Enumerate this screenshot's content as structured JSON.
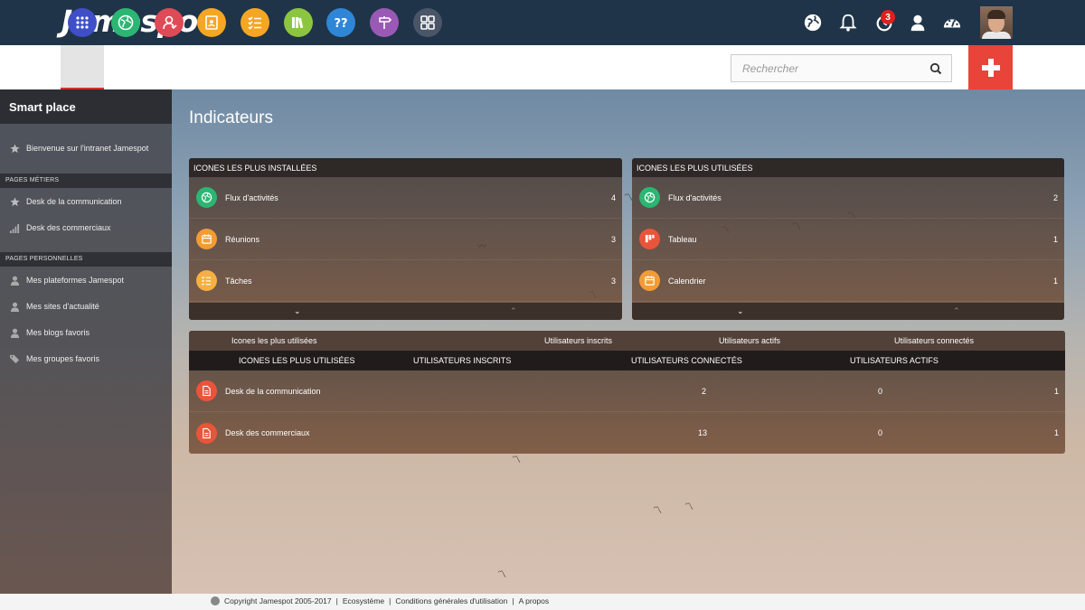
{
  "brand": {
    "name": "Jamespot",
    "dot": "."
  },
  "topbar": {
    "notifications_count": "3",
    "icons": [
      "globe-icon",
      "bell-icon",
      "activity-icon",
      "user-icon",
      "dashboard-icon"
    ]
  },
  "appbar": {
    "apps": [
      {
        "name": "apps-grid",
        "color": "#3f4fc7"
      },
      {
        "name": "activity-feed",
        "color": "#2bb673"
      },
      {
        "name": "users",
        "color": "#e04a57"
      },
      {
        "name": "directory",
        "color": "#f5a623"
      },
      {
        "name": "tasks",
        "color": "#f5a623"
      },
      {
        "name": "library",
        "color": "#8cc63f"
      },
      {
        "name": "faq",
        "color": "#2f86d6"
      },
      {
        "name": "signpost",
        "color": "#9b59b6"
      },
      {
        "name": "widgets",
        "color": "#4a5568"
      }
    ],
    "search_placeholder": "Rechercher",
    "add_color": "#e9443a"
  },
  "sidebar": {
    "title": "Smart place",
    "welcome": "Bienvenue sur l'intranet Jamespot",
    "section_metiers": "PAGES MÉTIERS",
    "metiers": [
      "Desk de la communication",
      "Desk des commerciaux"
    ],
    "section_perso": "PAGES PERSONNELLES",
    "perso": [
      "Mes plateformes Jamespot",
      "Mes sites d'actualité",
      "Mes blogs favoris",
      "Mes groupes favoris"
    ]
  },
  "main": {
    "title": "Indicateurs",
    "installed": {
      "header": "ICONES LES PLUS INSTALLÉES",
      "rows": [
        {
          "label": "Flux d'activités",
          "count": "4",
          "color": "#2bb673",
          "icon": "globe-icon"
        },
        {
          "label": "Réunions",
          "count": "3",
          "color": "#f39c34",
          "icon": "calendar-icon"
        },
        {
          "label": "Tâches",
          "count": "3",
          "color": "#f5b041",
          "icon": "tasks-icon"
        }
      ]
    },
    "used": {
      "header": "ICONES LES PLUS UTILISÉES",
      "rows": [
        {
          "label": "Flux d'activités",
          "count": "2",
          "color": "#2bb673",
          "icon": "globe-icon"
        },
        {
          "label": "Tableau",
          "count": "1",
          "color": "#e9553a",
          "icon": "board-icon"
        },
        {
          "label": "Calendrier",
          "count": "1",
          "color": "#f39c34",
          "icon": "calendar-icon"
        }
      ]
    },
    "stats": {
      "tabs": [
        "Icones les plus utilisées",
        "Utilisateurs inscrits",
        "Utilisateurs actifs",
        "Utilisateurs connectés"
      ],
      "columns": [
        "ICONES LES PLUS UTILISÉES",
        "UTILISATEURS INSCRITS",
        "UTILISATEURS CONNECTÉS",
        "UTILISATEURS ACTIFS"
      ],
      "rows": [
        {
          "label": "Desk de la communication",
          "a": "2",
          "b": "0",
          "c": "1"
        },
        {
          "label": "Desk des commerciaux",
          "a": "13",
          "b": "0",
          "c": "1"
        }
      ]
    }
  },
  "footer": {
    "copyright": "Copyright Jamespot 2005-2017",
    "sep1": "|",
    "ecosystem": "Ecosystème",
    "sep2": "|",
    "terms": "Conditions générales d'utilisation",
    "sep3": "|",
    "about": "A propos"
  }
}
